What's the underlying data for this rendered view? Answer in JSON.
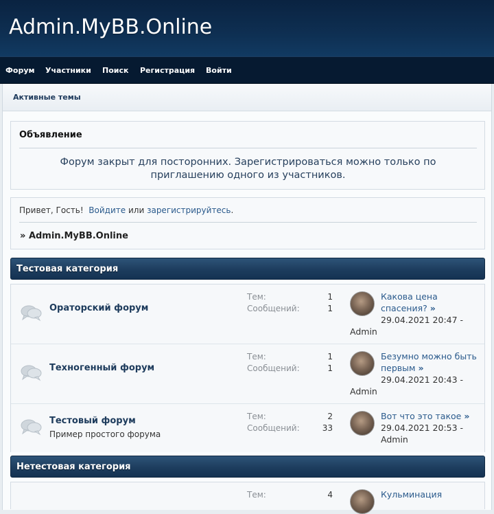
{
  "header": {
    "site_title": "Admin.MyBB.Online"
  },
  "nav": {
    "forum": "Форум",
    "members": "Участники",
    "search": "Поиск",
    "register": "Регистрация",
    "login": "Войти"
  },
  "subnav": {
    "active_topics": "Активные темы"
  },
  "announcement": {
    "title": "Объявление",
    "text_line1": "Форум закрыт для посторонних. Зарегистрироваться можно только по",
    "text_line2": "приглашению одного из участников."
  },
  "welcome": {
    "greeting": "Привет, Гость!",
    "login_link": "Войдите",
    "or": "или",
    "register_link": "зарегистрируйтесь",
    "period": ".",
    "breadcrumb_prefix": "»",
    "breadcrumb": "Admin.MyBB.Online"
  },
  "stat_labels": {
    "topics": "Тем:",
    "posts": "Сообщений:"
  },
  "arrow": "»",
  "categories": [
    {
      "name": "Тестовая категория",
      "forums": [
        {
          "name": "Ораторский форум",
          "description": "",
          "topics": "1",
          "posts": "1",
          "last_topic_line1": "Какова цена",
          "last_topic_line2": "спасения?",
          "last_date": "29.04.2021 20:47 -",
          "last_author": "Admin"
        },
        {
          "name": "Техногенный форум",
          "description": "",
          "topics": "1",
          "posts": "1",
          "last_topic_line1": "Безумно можно быть",
          "last_topic_line2": "первым",
          "last_date": "29.04.2021 20:43 -",
          "last_author": "Admin"
        },
        {
          "name": "Тестовый форум",
          "description": "Пример простого форума",
          "topics": "2",
          "posts": "33",
          "last_topic_line1": "Вот что это такое",
          "last_topic_line2": "",
          "last_date": "29.04.2021 20:53 -",
          "last_author": "Admin"
        }
      ]
    },
    {
      "name": "Нетестовая категория",
      "forums": [
        {
          "name": "",
          "description": "",
          "topics": "4",
          "posts": "",
          "last_topic_line1": "Кульминация",
          "last_topic_line2": "",
          "last_date": "",
          "last_author": ""
        }
      ]
    }
  ],
  "colors": {
    "header_bg": "#0e2f52",
    "navbar_bg": "#061a31",
    "category_bar": "#1d3d5e",
    "link": "#2a5a8c"
  }
}
